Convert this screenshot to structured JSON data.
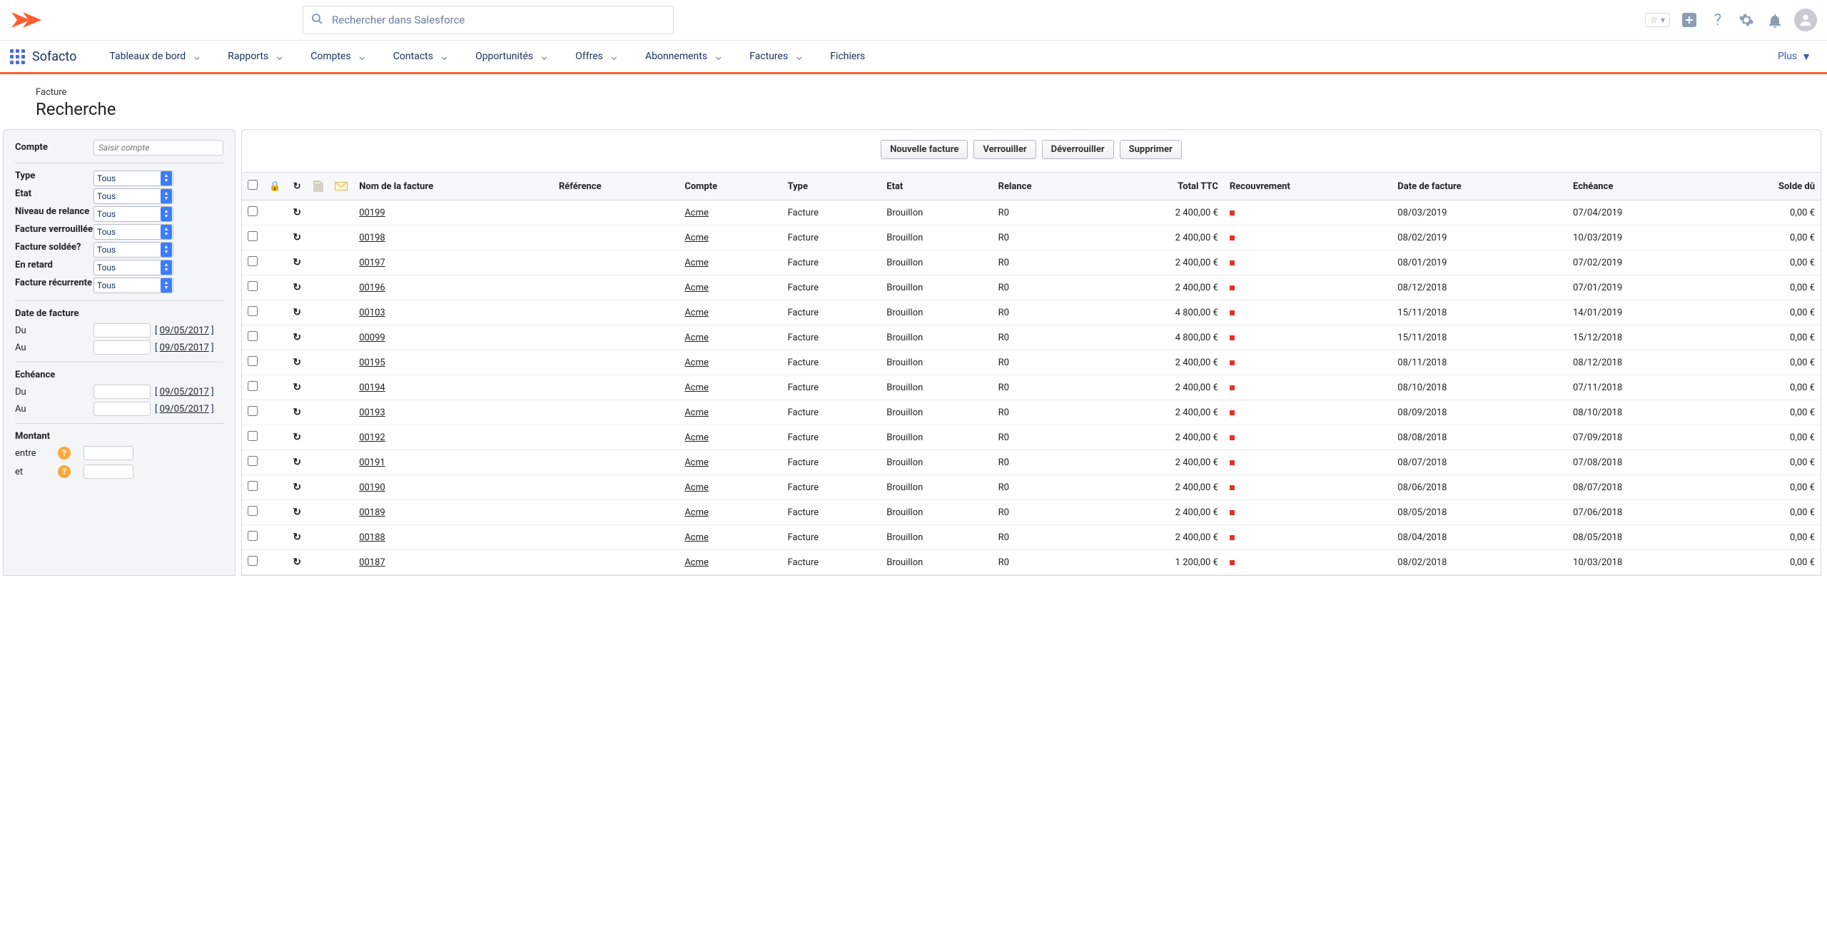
{
  "header": {
    "search_placeholder": "Rechercher dans Salesforce"
  },
  "nav": {
    "app_name": "Sofacto",
    "items": [
      {
        "label": "Tableaux de bord",
        "dropdown": true
      },
      {
        "label": "Rapports",
        "dropdown": true
      },
      {
        "label": "Comptes",
        "dropdown": true
      },
      {
        "label": "Contacts",
        "dropdown": true
      },
      {
        "label": "Opportunités",
        "dropdown": true
      },
      {
        "label": "Offres",
        "dropdown": true
      },
      {
        "label": "Abonnements",
        "dropdown": true
      },
      {
        "label": "Factures",
        "dropdown": true
      },
      {
        "label": "Fichiers",
        "dropdown": false
      }
    ],
    "more_label": "Plus"
  },
  "page": {
    "subtitle": "Facture",
    "title": "Recherche"
  },
  "sidebar": {
    "compte_label": "Compte",
    "compte_placeholder": "Saisir compte",
    "filters": [
      {
        "label": "Type",
        "value": "Tous"
      },
      {
        "label": "Etat",
        "value": "Tous"
      },
      {
        "label": "Niveau de relance",
        "value": "Tous"
      },
      {
        "label": "Facture verrouillée",
        "value": "Tous"
      },
      {
        "label": "Facture soldée?",
        "value": "Tous"
      },
      {
        "label": "En retard",
        "value": "Tous"
      },
      {
        "label": "Facture récurrente",
        "value": "Tous"
      }
    ],
    "date_facture": {
      "title": "Date de facture",
      "from_label": "Du",
      "to_label": "Au",
      "link": "09/05/2017"
    },
    "echeance": {
      "title": "Echéance",
      "from_label": "Du",
      "to_label": "Au",
      "link": "09/05/2017"
    },
    "montant": {
      "title": "Montant",
      "between_label": "entre",
      "and_label": "et"
    }
  },
  "toolbar": {
    "new_label": "Nouvelle facture",
    "lock_label": "Verrouiller",
    "unlock_label": "Déverrouiller",
    "delete_label": "Supprimer"
  },
  "table": {
    "headers": {
      "name": "Nom de la facture",
      "reference": "Référence",
      "compte": "Compte",
      "type": "Type",
      "etat": "Etat",
      "relance": "Relance",
      "total": "Total TTC",
      "recouvrement": "Recouvrement",
      "date": "Date de facture",
      "echeance": "Echéance",
      "solde": "Solde dû"
    },
    "rows": [
      {
        "name": "00199",
        "compte": "Acme",
        "type": "Facture",
        "etat": "Brouillon",
        "relance": "R0",
        "total": "2 400,00 €",
        "date": "08/03/2019",
        "echeance": "07/04/2019",
        "solde": "0,00 €"
      },
      {
        "name": "00198",
        "compte": "Acme",
        "type": "Facture",
        "etat": "Brouillon",
        "relance": "R0",
        "total": "2 400,00 €",
        "date": "08/02/2019",
        "echeance": "10/03/2019",
        "solde": "0,00 €"
      },
      {
        "name": "00197",
        "compte": "Acme",
        "type": "Facture",
        "etat": "Brouillon",
        "relance": "R0",
        "total": "2 400,00 €",
        "date": "08/01/2019",
        "echeance": "07/02/2019",
        "solde": "0,00 €"
      },
      {
        "name": "00196",
        "compte": "Acme",
        "type": "Facture",
        "etat": "Brouillon",
        "relance": "R0",
        "total": "2 400,00 €",
        "date": "08/12/2018",
        "echeance": "07/01/2019",
        "solde": "0,00 €"
      },
      {
        "name": "00103",
        "compte": "Acme",
        "type": "Facture",
        "etat": "Brouillon",
        "relance": "R0",
        "total": "4 800,00 €",
        "date": "15/11/2018",
        "echeance": "14/01/2019",
        "solde": "0,00 €"
      },
      {
        "name": "00099",
        "compte": "Acme",
        "type": "Facture",
        "etat": "Brouillon",
        "relance": "R0",
        "total": "4 800,00 €",
        "date": "15/11/2018",
        "echeance": "15/12/2018",
        "solde": "0,00 €"
      },
      {
        "name": "00195",
        "compte": "Acme",
        "type": "Facture",
        "etat": "Brouillon",
        "relance": "R0",
        "total": "2 400,00 €",
        "date": "08/11/2018",
        "echeance": "08/12/2018",
        "solde": "0,00 €"
      },
      {
        "name": "00194",
        "compte": "Acme",
        "type": "Facture",
        "etat": "Brouillon",
        "relance": "R0",
        "total": "2 400,00 €",
        "date": "08/10/2018",
        "echeance": "07/11/2018",
        "solde": "0,00 €"
      },
      {
        "name": "00193",
        "compte": "Acme",
        "type": "Facture",
        "etat": "Brouillon",
        "relance": "R0",
        "total": "2 400,00 €",
        "date": "08/09/2018",
        "echeance": "08/10/2018",
        "solde": "0,00 €"
      },
      {
        "name": "00192",
        "compte": "Acme",
        "type": "Facture",
        "etat": "Brouillon",
        "relance": "R0",
        "total": "2 400,00 €",
        "date": "08/08/2018",
        "echeance": "07/09/2018",
        "solde": "0,00 €"
      },
      {
        "name": "00191",
        "compte": "Acme",
        "type": "Facture",
        "etat": "Brouillon",
        "relance": "R0",
        "total": "2 400,00 €",
        "date": "08/07/2018",
        "echeance": "07/08/2018",
        "solde": "0,00 €"
      },
      {
        "name": "00190",
        "compte": "Acme",
        "type": "Facture",
        "etat": "Brouillon",
        "relance": "R0",
        "total": "2 400,00 €",
        "date": "08/06/2018",
        "echeance": "08/07/2018",
        "solde": "0,00 €"
      },
      {
        "name": "00189",
        "compte": "Acme",
        "type": "Facture",
        "etat": "Brouillon",
        "relance": "R0",
        "total": "2 400,00 €",
        "date": "08/05/2018",
        "echeance": "07/06/2018",
        "solde": "0,00 €"
      },
      {
        "name": "00188",
        "compte": "Acme",
        "type": "Facture",
        "etat": "Brouillon",
        "relance": "R0",
        "total": "2 400,00 €",
        "date": "08/04/2018",
        "echeance": "08/05/2018",
        "solde": "0,00 €"
      },
      {
        "name": "00187",
        "compte": "Acme",
        "type": "Facture",
        "etat": "Brouillon",
        "relance": "R0",
        "total": "1 200,00 €",
        "date": "08/02/2018",
        "echeance": "10/03/2018",
        "solde": "0,00 €"
      }
    ]
  }
}
